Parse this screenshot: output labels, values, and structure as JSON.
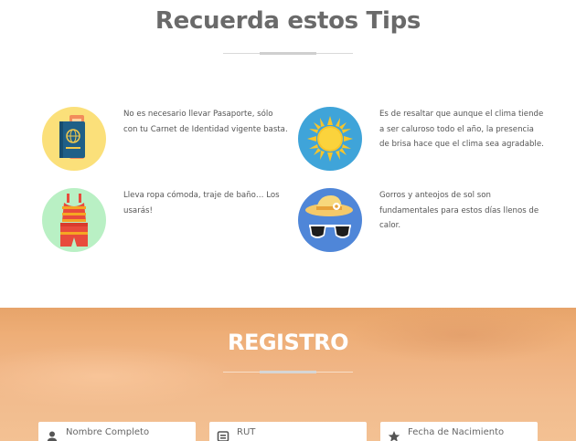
{
  "tips_section": {
    "title": "Recuerda estos Tips",
    "tips": [
      {
        "icon": "passport-icon",
        "text": "No es necesario llevar Pasaporte, sólo con tu Carnet de Identidad vigente basta."
      },
      {
        "icon": "sun-icon",
        "text": "Es de resaltar que aunque el clima tiende a ser caluroso todo el año, la presencia de brisa hace que el clima sea agradable."
      },
      {
        "icon": "swimsuit-icon",
        "text": "Lleva ropa cómoda, traje de baño… Los usarás!"
      },
      {
        "icon": "hat-sunglasses-icon",
        "text": "Gorros y anteojos de sol son fundamentales para estos días llenos de calor."
      }
    ]
  },
  "registro_section": {
    "title": "REGISTRO",
    "fields": [
      {
        "icon": "user-icon",
        "placeholder": "Nombre Completo"
      },
      {
        "icon": "id-card-icon",
        "placeholder": "RUT"
      },
      {
        "icon": "star-icon",
        "placeholder": "Fecha de Nacimiento"
      }
    ]
  },
  "colors": {
    "passport_bg": "#fbe07a",
    "sun_bg": "#3fa4d9",
    "swimsuit_bg": "#b9f0c4",
    "hat_bg": "#4f86d8",
    "registro_bg": "#f0b585"
  }
}
